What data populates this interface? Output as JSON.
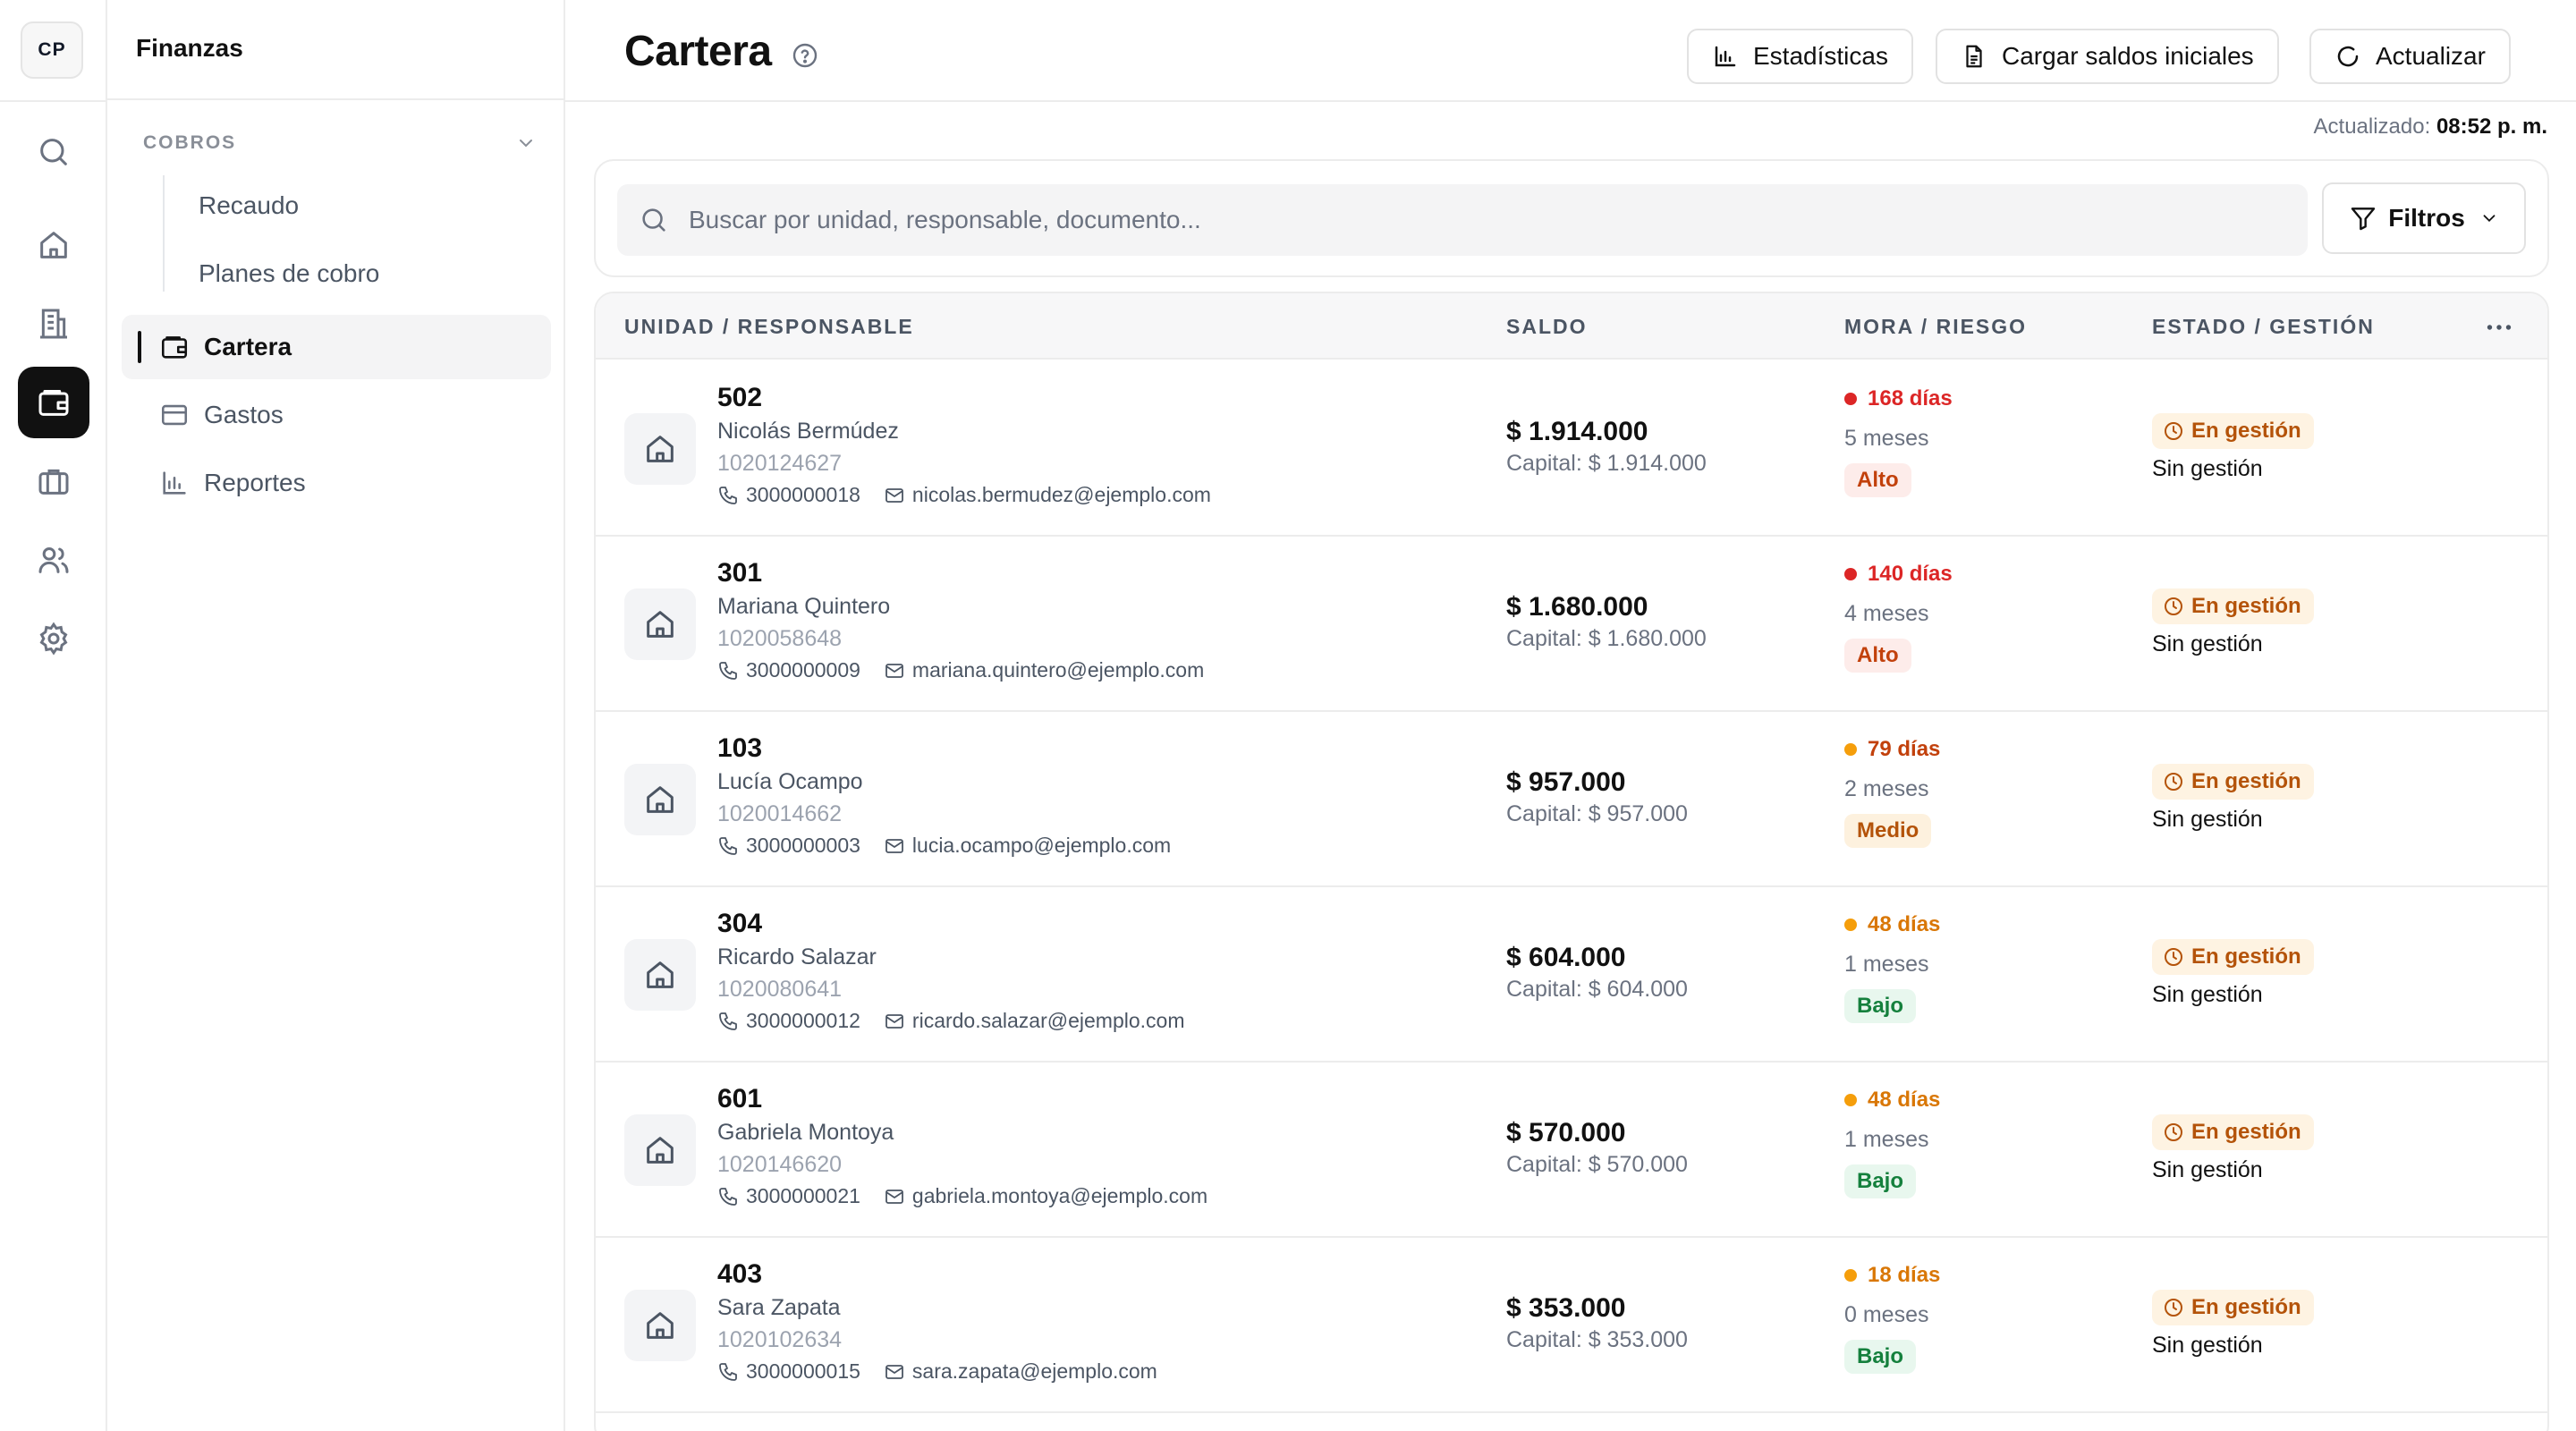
{
  "app": {
    "logo": "CP",
    "section": "Finanzas"
  },
  "rail": [
    {
      "icon": "search-icon",
      "active": false
    },
    {
      "icon": "home-icon",
      "active": false
    },
    {
      "icon": "building-icon",
      "active": false
    },
    {
      "icon": "wallet-icon",
      "active": true
    },
    {
      "icon": "briefcase-icon",
      "active": false
    },
    {
      "icon": "users-icon",
      "active": false
    },
    {
      "icon": "settings-icon",
      "active": false
    }
  ],
  "submenu": {
    "group_label": "COBROS",
    "children": [
      "Recaudo",
      "Planes de cobro"
    ],
    "items": [
      {
        "label": "Cartera",
        "icon": "wallet-icon",
        "active": true
      },
      {
        "label": "Gastos",
        "icon": "credit-card-icon",
        "active": false
      },
      {
        "label": "Reportes",
        "icon": "bar-chart-icon",
        "active": false
      }
    ]
  },
  "header": {
    "title": "Cartera",
    "buttons": {
      "stats": "Estadísticas",
      "load": "Cargar saldos iniciales",
      "refresh": "Actualizar"
    },
    "updated_label": "Actualizado:",
    "updated_time": "08:52 p. m."
  },
  "search": {
    "placeholder": "Buscar por unidad, responsable, documento...",
    "filters_label": "Filtros"
  },
  "table": {
    "columns": [
      "UNIDAD / RESPONSABLE",
      "SALDO",
      "MORA / RIESGO",
      "ESTADO / GESTIÓN"
    ],
    "rows": [
      {
        "unit": "502",
        "name": "Nicolás Bermúdez",
        "document": "1020124627",
        "phone": "3000000018",
        "email": "nicolas.bermudez@ejemplo.com",
        "saldo": "$ 1.914.000",
        "capital": "Capital: $ 1.914.000",
        "mora": "168 días",
        "meses": "5 meses",
        "riesgo": "Alto",
        "level": "high",
        "estado": "En gestión",
        "gestion": "Sin gestión"
      },
      {
        "unit": "301",
        "name": "Mariana Quintero",
        "document": "1020058648",
        "phone": "3000000009",
        "email": "mariana.quintero@ejemplo.com",
        "saldo": "$ 1.680.000",
        "capital": "Capital: $ 1.680.000",
        "mora": "140 días",
        "meses": "4 meses",
        "riesgo": "Alto",
        "level": "high",
        "estado": "En gestión",
        "gestion": "Sin gestión"
      },
      {
        "unit": "103",
        "name": "Lucía Ocampo",
        "document": "1020014662",
        "phone": "3000000003",
        "email": "lucia.ocampo@ejemplo.com",
        "saldo": "$ 957.000",
        "capital": "Capital: $ 957.000",
        "mora": "79 días",
        "meses": "2 meses",
        "riesgo": "Medio",
        "level": "medium",
        "estado": "En gestión",
        "gestion": "Sin gestión"
      },
      {
        "unit": "304",
        "name": "Ricardo Salazar",
        "document": "1020080641",
        "phone": "3000000012",
        "email": "ricardo.salazar@ejemplo.com",
        "saldo": "$ 604.000",
        "capital": "Capital: $ 604.000",
        "mora": "48 días",
        "meses": "1 meses",
        "riesgo": "Bajo",
        "level": "low",
        "estado": "En gestión",
        "gestion": "Sin gestión"
      },
      {
        "unit": "601",
        "name": "Gabriela Montoya",
        "document": "1020146620",
        "phone": "3000000021",
        "email": "gabriela.montoya@ejemplo.com",
        "saldo": "$ 570.000",
        "capital": "Capital: $ 570.000",
        "mora": "48 días",
        "meses": "1 meses",
        "riesgo": "Bajo",
        "level": "low",
        "estado": "En gestión",
        "gestion": "Sin gestión"
      },
      {
        "unit": "403",
        "name": "Sara Zapata",
        "document": "1020102634",
        "phone": "3000000015",
        "email": "sara.zapata@ejemplo.com",
        "saldo": "$ 353.000",
        "capital": "Capital: $ 353.000",
        "mora": "18 días",
        "meses": "0 meses",
        "riesgo": "Bajo",
        "level": "low",
        "estado": "En gestión",
        "gestion": "Sin gestión"
      }
    ]
  },
  "colors": {
    "high_dot": "#dc2626",
    "high_text": "#dc2626",
    "high_badge_bg": "#fdecea",
    "high_badge_text": "#c2410c",
    "medium_dot": "#f59e0b",
    "medium_text": "#c2410c",
    "medium_badge_bg": "#fdf1de",
    "medium_badge_text": "#b45309",
    "low_dot": "#f59e0b",
    "low_text": "#d97706",
    "low_badge_bg": "#e8f7ee",
    "low_badge_text": "#15803d"
  }
}
